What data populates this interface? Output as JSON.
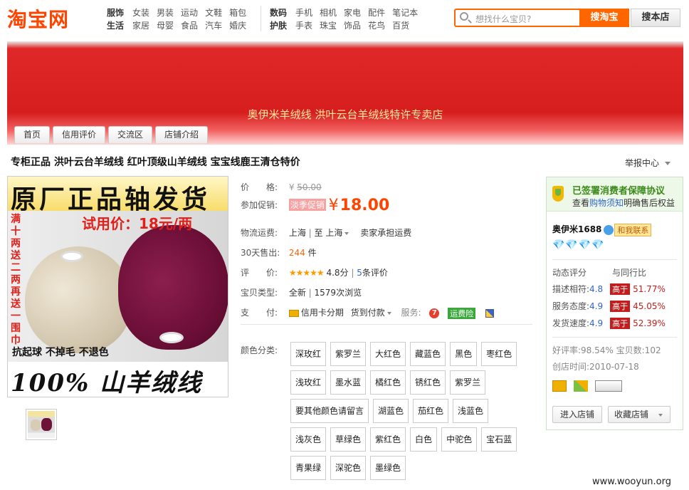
{
  "header": {
    "logo": "淘宝网",
    "cats1_row1": [
      "服饰",
      "女装",
      "男装",
      "运动",
      "文鞋",
      "箱包"
    ],
    "cats1_row2": [
      "生活",
      "家居",
      "母婴",
      "食品",
      "汽车",
      "婚庆"
    ],
    "cats2_row1": [
      "数码",
      "手机",
      "相机",
      "家电",
      "配件",
      "笔记本"
    ],
    "cats2_row2": [
      "护肤",
      "手表",
      "珠宝",
      "饰品",
      "花鸟",
      "百货"
    ],
    "search_placeholder": "想找什么宝贝?",
    "search_taobao": "搜淘宝",
    "search_shop": "搜本店"
  },
  "shop": {
    "banner_name": "奥伊米羊绒线 洪叶云台羊绒线特许专卖店",
    "tabs": [
      "首页",
      "信用评价",
      "交流区",
      "店铺介绍"
    ]
  },
  "product": {
    "title": "专柜正品 洪叶云台羊绒线 红叶顶级山羊绒线 宝宝线鹿王清仓特价",
    "report": "举报中心",
    "image_text": {
      "top": "原厂正品轴发货",
      "trial": "试用价：18元/两",
      "side": "满十两送二两再送一围巾",
      "pilling": "抗起球 不掉毛 不退色",
      "bottom": "100% 山羊绒线"
    }
  },
  "info": {
    "price_label": "价　　格:",
    "price_old_symbol": "¥",
    "price_old": "50.00",
    "promo_label": "参加促销:",
    "promo_tag": "淡季促销",
    "promo_symbol": "¥",
    "promo_price": "18.00",
    "shipping_label": "物流运费:",
    "shipping_from": "上海",
    "shipping_to_word": "至",
    "shipping_to": "上海",
    "shipping_note": "卖家承担运费",
    "sold_label": "30天售出:",
    "sold_count": "244",
    "sold_unit": "件",
    "rating_label": "评　　价:",
    "rating_stars": "★★★★★",
    "rating_score": "4.8分",
    "rating_count_num": "5",
    "rating_count_text": "条评价",
    "type_label": "宝贝类型:",
    "type_value": "全新",
    "views": "1579次浏览",
    "pay_label": "支　　付:",
    "pay_installment": "信用卡分期",
    "pay_cod": "货到付款",
    "service_label": "服务:",
    "service_7": "7",
    "service_yunfei": "运费险",
    "colors_label": "颜色分类:",
    "colors": [
      "深玫红",
      "紫罗兰",
      "大红色",
      "藏蓝色",
      "黑色",
      "枣红色",
      "浅玫红",
      "墨水蓝",
      "橘红色",
      "锈红色",
      "紫罗兰",
      "要其他颜色请留言",
      "湖蓝色",
      "茄红色",
      "浅蓝色",
      "浅灰色",
      "草绿色",
      "紫红色",
      "白色",
      "中驼色",
      "宝石蓝",
      "青果绿",
      "深驼色",
      "墨绿色"
    ]
  },
  "seller": {
    "protect_title": "已签署消费者保障协议",
    "protect_sub_pre": "查看",
    "protect_link": "购物须知",
    "protect_sub_post": "明确售后权益",
    "name": "奥伊米1688",
    "chat": "和我联系",
    "diamonds": "💎💎💎💎",
    "dsr_title": "动态评分",
    "dsr_compare": "与同行比",
    "dsr": [
      {
        "label": "描述相符:",
        "score": "4.8",
        "tag": "高于",
        "pct": "51.77%"
      },
      {
        "label": "服务态度:",
        "score": "4.9",
        "tag": "高于",
        "pct": "45.05%"
      },
      {
        "label": "发货速度:",
        "score": "4.9",
        "tag": "高于",
        "pct": "52.39%"
      }
    ],
    "good_rate": "好评率:98.54%",
    "items_count": "宝贝数:102",
    "created": "创店时间:2010-07-18",
    "enter_shop": "进入店铺",
    "fav_shop": "收藏店铺"
  },
  "watermark": "www.wooyun.org"
}
